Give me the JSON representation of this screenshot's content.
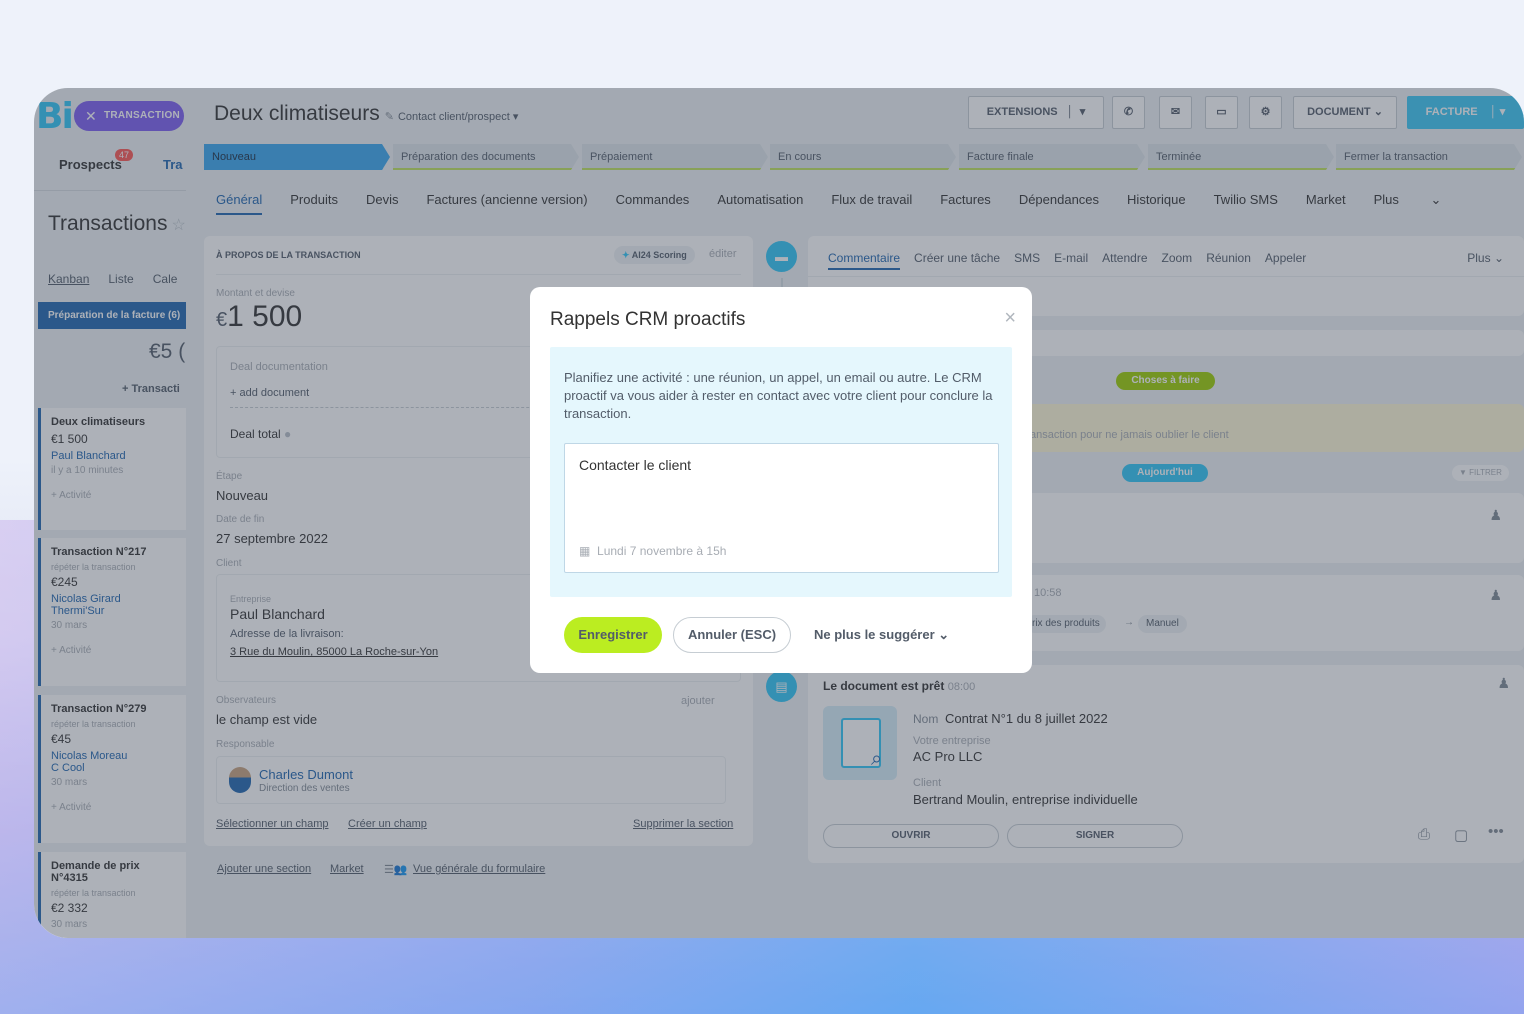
{
  "left": {
    "logo": "Bi",
    "chip": "TRANSACTION",
    "nav_prospects": "Prospects",
    "nav_badge": "47",
    "nav_tra": "Tra",
    "title": "Transactions",
    "views": [
      "Kanban",
      "Liste",
      "Cale"
    ],
    "stage": "Préparation de la facture (6)",
    "sum": "€5 (",
    "add": "+ Transacti",
    "cards": [
      {
        "title": "Deux climatiseurs",
        "sub": "",
        "amount": "€1 500",
        "people": [
          "Paul Blanchard"
        ],
        "date": "il y a 10 minutes",
        "act": "+ Activité"
      },
      {
        "title": "Transaction N°217",
        "sub": "répéter la transaction",
        "amount": "€245",
        "people": [
          "Nicolas Girard",
          "Thermi'Sur"
        ],
        "date": "30 mars",
        "act": "+ Activité"
      },
      {
        "title": "Transaction N°279",
        "sub": "répéter la transaction",
        "amount": "€45",
        "people": [
          "Nicolas Moreau",
          "C Cool"
        ],
        "date": "30 mars",
        "act": "+ Activité"
      },
      {
        "title": "Demande de prix N°4315",
        "sub": "répéter la transaction",
        "amount": "€2 332",
        "people": [],
        "date": "30 mars",
        "act": ""
      }
    ]
  },
  "header": {
    "title": "Deux climatiseurs",
    "subtitle": "Contact client/prospect",
    "btn_extensions": "EXTENSIONS",
    "btn_document": "DOCUMENT",
    "btn_facture": "FACTURE"
  },
  "stages": [
    "Nouveau",
    "Préparation des documents",
    "Prépaiement",
    "En cours",
    "Facture finale",
    "Terminée",
    "Fermer la transaction"
  ],
  "tabs": [
    "Général",
    "Produits",
    "Devis",
    "Factures (ancienne version)",
    "Commandes",
    "Automatisation",
    "Flux de travail",
    "Factures",
    "Dépendances",
    "Historique",
    "Twilio SMS",
    "Market",
    "Plus"
  ],
  "about": {
    "heading": "À PROPOS DE LA TRANSACTION",
    "scoring": "AI24 Scoring",
    "edit": "éditer",
    "amount_label": "Montant et devise",
    "currency": "€",
    "amount": "1 500",
    "doc_label": "Deal documentation",
    "add_doc": "+ add document",
    "deal_total": "Deal total",
    "stage_label": "Étape",
    "stage_value": "Nouveau",
    "end_label": "Date de fin",
    "end_value": "27 septembre 2022",
    "client_label": "Client",
    "company_label": "Entreprise",
    "company_value": "Paul Blanchard",
    "address_label": "Adresse de la livraison:",
    "address_value": "3 Rue du Moulin, 85000 La Roche-sur-Yon",
    "observers_label": "Observateurs",
    "observers_add": "ajouter",
    "observers_value": "le champ est vide",
    "resp_label": "Responsable",
    "resp_name": "Charles Dumont",
    "resp_role": "Direction des ventes",
    "link_select": "Sélectionner un champ",
    "link_create": "Créer un champ",
    "link_delete": "Supprimer la section",
    "link_add_section": "Ajouter une section",
    "link_market": "Market",
    "link_form": "Vue générale du formulaire"
  },
  "activity": {
    "tabs": [
      "Commentaire",
      "Créer une tâche",
      "SMS",
      "E-mail",
      "Attendre",
      "Zoom",
      "Réunion",
      "Appeler"
    ],
    "more": "Plus",
    "todo": "Choses à faire",
    "reminder_tail": "ansaction pour ne jamais oublier le client",
    "today": "Aujourd'hui",
    "filter": "FILTRER",
    "time1": "10:58",
    "chip1": "rix des produits",
    "chip2": "Manuel",
    "doc_ready": "Le document est prêt",
    "doc_time": "08:00",
    "nom_label": "Nom",
    "nom_value": "Contrat N°1 du 8 juillet 2022",
    "company_label": "Votre entreprise",
    "company_value": "AC Pro LLC",
    "client_label": "Client",
    "client_value": "Bertrand Moulin, entreprise individuelle",
    "open": "OUVRIR",
    "sign": "SIGNER"
  },
  "modal": {
    "title": "Rappels CRM proactifs",
    "text": "Planifiez une activité : une réunion, un appel, un email ou autre. Le CRM proactif va vous aider à rester en contact avec votre client pour conclure la transaction.",
    "input_value": "Contacter le client",
    "date": "Lundi 7 novembre à 15h",
    "save": "Enregistrer",
    "cancel": "Annuler (ESC)",
    "never": "Ne plus le suggérer"
  }
}
